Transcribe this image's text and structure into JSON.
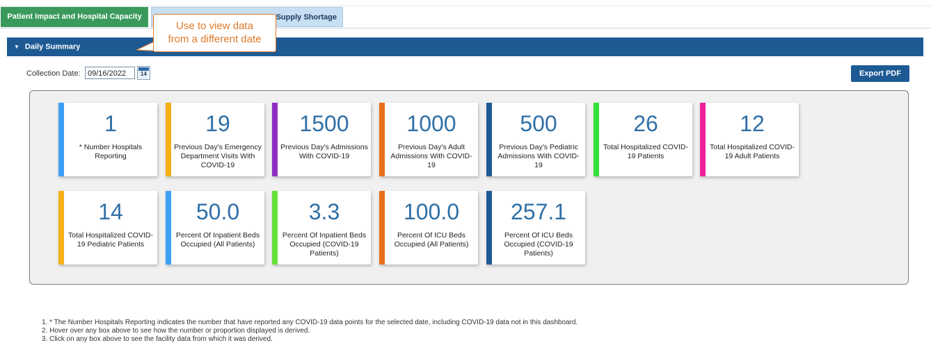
{
  "tabs": [
    {
      "label": "Patient Impact and Hospital Capacity",
      "active": true
    },
    {
      "label": "Supply Shortage",
      "active": false
    }
  ],
  "section": {
    "title": "Daily Summary"
  },
  "collection": {
    "label": "Collection Date:",
    "value": "09/16/2022",
    "calendar_day": "14"
  },
  "export_label": "Export PDF",
  "callout": {
    "line1": "Use to view data",
    "line2": "from a different date"
  },
  "cards": [
    {
      "value": "1",
      "label": "* Number Hospitals Reporting",
      "color": "#3d9ff5"
    },
    {
      "value": "19",
      "label": "Previous Day's Emergency Department Visits With COVID-19",
      "color": "#f5b017"
    },
    {
      "value": "1500",
      "label": "Previous Day's Admissions With COVID-19",
      "color": "#8e2fc4"
    },
    {
      "value": "1000",
      "label": "Previous Day's Adult Admissions With COVID-19",
      "color": "#e8701c"
    },
    {
      "value": "500",
      "label": "Previous Day's Pediatric Admissions With COVID-19",
      "color": "#1d5a94"
    },
    {
      "value": "26",
      "label": "Total Hospitalized COVID-19 Patients",
      "color": "#35e03a"
    },
    {
      "value": "12",
      "label": "Total Hospitalized COVID-19 Adult Patients",
      "color": "#f01f9c"
    },
    {
      "value": "14",
      "label": "Total Hospitalized COVID-19 Pediatric Patients",
      "color": "#f5b017"
    },
    {
      "value": "50.0",
      "label": "Percent Of Inpatient Beds Occupied (All Patients)",
      "color": "#3d9ff5"
    },
    {
      "value": "3.3",
      "label": "Percent Of Inpatient Beds Occupied (COVID-19 Patients)",
      "color": "#66e03a"
    },
    {
      "value": "100.0",
      "label": "Percent Of ICU Beds Occupied (All Patients)",
      "color": "#e8701c"
    },
    {
      "value": "257.1",
      "label": "Percent Of ICU Beds Occupied (COVID-19 Patients)",
      "color": "#1d5a94"
    }
  ],
  "notes": [
    "1. * The Number Hospitals Reporting indicates the number that have reported any COVID-19 data points for the selected date, including COVID-19 data not in this dashboard.",
    "2. Hover over any box above to see how the number or proportion displayed is derived.",
    "3. Click on any box above to see the facility data from which it was derived."
  ]
}
